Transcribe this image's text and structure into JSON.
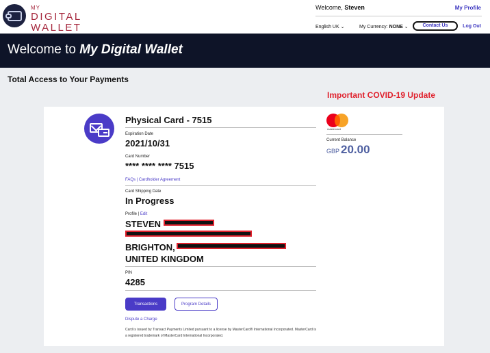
{
  "header": {
    "brand_my": "MY",
    "brand_line1": "DIGITAL",
    "brand_line2": "WALLET",
    "welcome_prefix": "Welcome, ",
    "user_name": "Steven",
    "my_profile": "My Profile",
    "language": "English UK",
    "currency_label": "My Currency: ",
    "currency_value": "NONE",
    "contact_us": "Contact Us",
    "log_out": "Log Out"
  },
  "banner": {
    "prefix": "Welcome to ",
    "emphasis": "My Digital Wallet"
  },
  "subtitle": "Total Access to Your Payments",
  "covid_link": "Important COVID-19 Update",
  "card": {
    "title": "Physical Card - 7515",
    "expiration_label": "Expiration Date",
    "expiration_value": "2021/10/31",
    "number_label": "Card Number",
    "number_value": "**** **** **** 7515",
    "faqs": "FAQs",
    "link_sep": " | ",
    "cardholder_agreement": "Cardholder Agreement",
    "shipping_label": "Card Shipping Date",
    "shipping_value": "In Progress",
    "profile_label": "Profile | ",
    "profile_edit": "Edit",
    "profile_name": "STEVEN",
    "profile_city": "BRIGHTON,",
    "profile_country": "UNITED KINGDOM",
    "pin_label": "PIN",
    "pin_value": "4285",
    "transactions_btn": "Transactions",
    "program_details_btn": "Program Details",
    "dispute_link": "Dispute a Charge",
    "disclaimer": "Card is issued by Transact Payments Limited pursuant to a license by MasterCard® International Incorporated. MasterCard is a registered trademark of MasterCard International Incorporated."
  },
  "balance": {
    "brand_word": "mastercard",
    "label": "Current Balance",
    "currency": "GBP",
    "amount": "20.00"
  },
  "icons": {
    "logo": "wallet-logo-icon",
    "card_type": "envelope-card-icon",
    "chevron": "chevron-down-icon"
  },
  "colors": {
    "brand": "#a6293e",
    "accent": "#4a3bc7",
    "banner": "#0e1428",
    "alert": "#e0212d",
    "balance": "#4e5fa0"
  }
}
